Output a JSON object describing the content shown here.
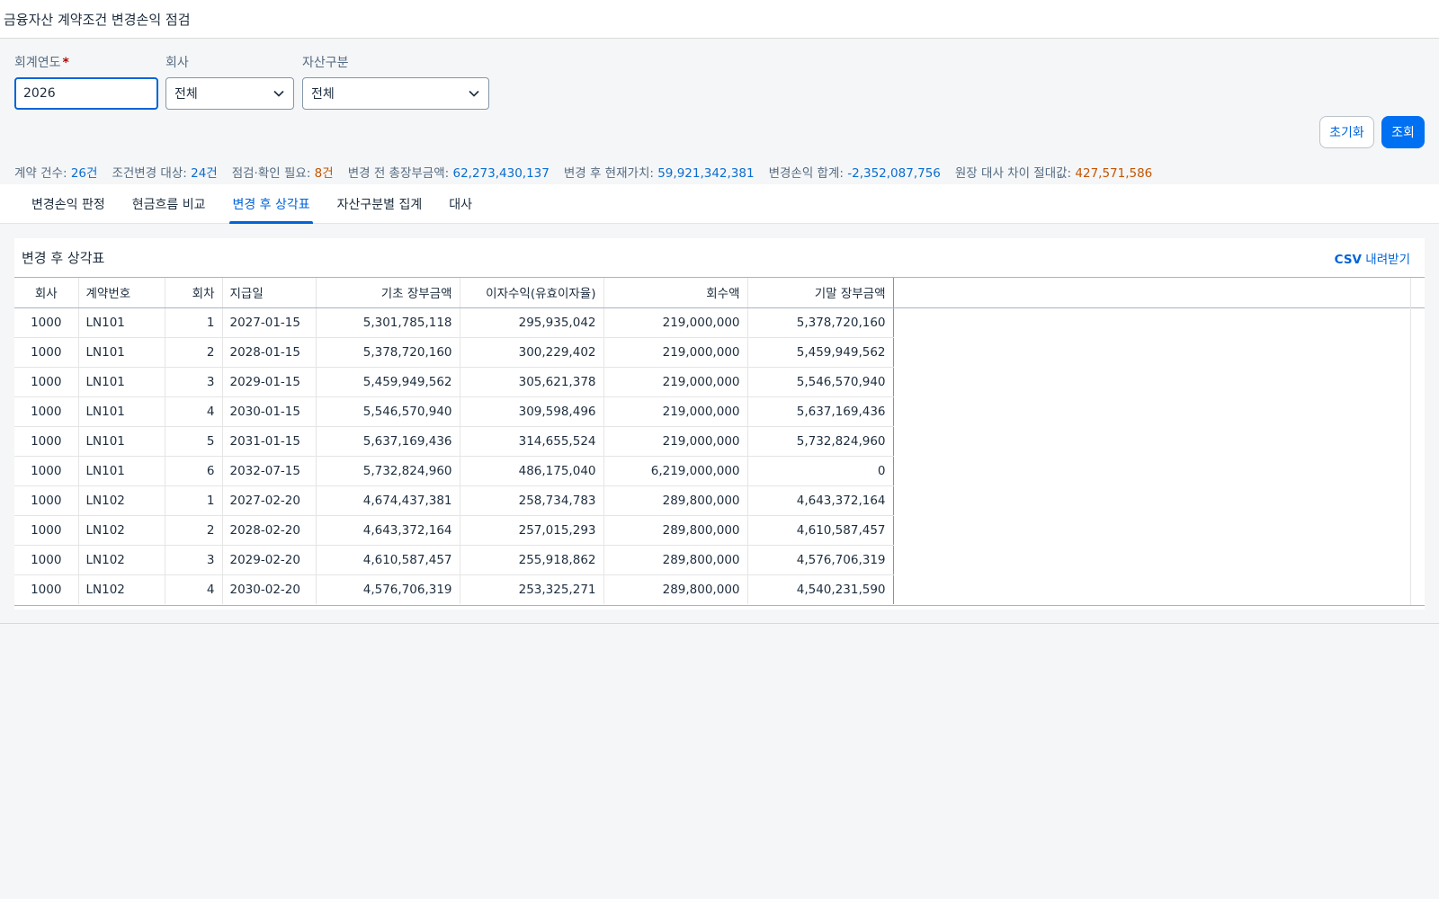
{
  "app": {
    "title": "금융자산 계약조건 변경손익 점검"
  },
  "filters": {
    "year": {
      "label": "회계연도",
      "required_mark": "*",
      "value": "2026"
    },
    "company": {
      "label": "회사",
      "value": "전체"
    },
    "asset_type": {
      "label": "자산구분",
      "value": "전체"
    },
    "reset_label": "초기화",
    "search_label": "조회"
  },
  "kpis": [
    {
      "label": "계약 건수:",
      "value": "26건",
      "tone": "info"
    },
    {
      "label": "조건변경 대상:",
      "value": "24건",
      "tone": "info"
    },
    {
      "label": "점검·확인 필요:",
      "value": "8건",
      "tone": "warn"
    },
    {
      "label": "변경 전 총장부금액:",
      "value": "62,273,430,137",
      "tone": "info"
    },
    {
      "label": "변경 후 현재가치:",
      "value": "59,921,342,381",
      "tone": "info"
    },
    {
      "label": "변경손익 합계:",
      "value": "-2,352,087,756",
      "tone": "info"
    },
    {
      "label": "원장 대사 차이 절대값:",
      "value": "427,571,586",
      "tone": "warn"
    }
  ],
  "tabs": [
    {
      "label": "변경손익 판정",
      "active": false
    },
    {
      "label": "현금흐름 비교",
      "active": false
    },
    {
      "label": "변경 후 상각표",
      "active": true
    },
    {
      "label": "자산구분별 집계",
      "active": false
    },
    {
      "label": "대사",
      "active": false
    }
  ],
  "panel": {
    "title": "변경 후 상각표",
    "csv_bold": "CSV",
    "csv_rest": " 내려받기"
  },
  "table": {
    "columns": [
      "회사",
      "계약번호",
      "회차",
      "지급일",
      "기초 장부금액",
      "이자수익(유효이자율)",
      "회수액",
      "기말 장부금액"
    ],
    "rows": [
      [
        "1000",
        "LN101",
        "1",
        "2027-01-15",
        "5,301,785,118",
        "295,935,042",
        "219,000,000",
        "5,378,720,160"
      ],
      [
        "1000",
        "LN101",
        "2",
        "2028-01-15",
        "5,378,720,160",
        "300,229,402",
        "219,000,000",
        "5,459,949,562"
      ],
      [
        "1000",
        "LN101",
        "3",
        "2029-01-15",
        "5,459,949,562",
        "305,621,378",
        "219,000,000",
        "5,546,570,940"
      ],
      [
        "1000",
        "LN101",
        "4",
        "2030-01-15",
        "5,546,570,940",
        "309,598,496",
        "219,000,000",
        "5,637,169,436"
      ],
      [
        "1000",
        "LN101",
        "5",
        "2031-01-15",
        "5,637,169,436",
        "314,655,524",
        "219,000,000",
        "5,732,824,960"
      ],
      [
        "1000",
        "LN101",
        "6",
        "2032-07-15",
        "5,732,824,960",
        "486,175,040",
        "6,219,000,000",
        "0"
      ],
      [
        "1000",
        "LN102",
        "1",
        "2027-02-20",
        "4,674,437,381",
        "258,734,783",
        "289,800,000",
        "4,643,372,164"
      ],
      [
        "1000",
        "LN102",
        "2",
        "2028-02-20",
        "4,643,372,164",
        "257,015,293",
        "289,800,000",
        "4,610,587,457"
      ],
      [
        "1000",
        "LN102",
        "3",
        "2029-02-20",
        "4,610,587,457",
        "255,918,862",
        "289,800,000",
        "4,576,706,319"
      ],
      [
        "1000",
        "LN102",
        "4",
        "2030-02-20",
        "4,576,706,319",
        "253,325,271",
        "289,800,000",
        "4,540,231,590"
      ]
    ]
  },
  "colors": {
    "accent": "#0064d9",
    "primary_button": "#0070f2",
    "warn": "#c35500",
    "info": "#0a6ed1"
  },
  "icons": {
    "select_arrow": "chevron-down-icon"
  }
}
